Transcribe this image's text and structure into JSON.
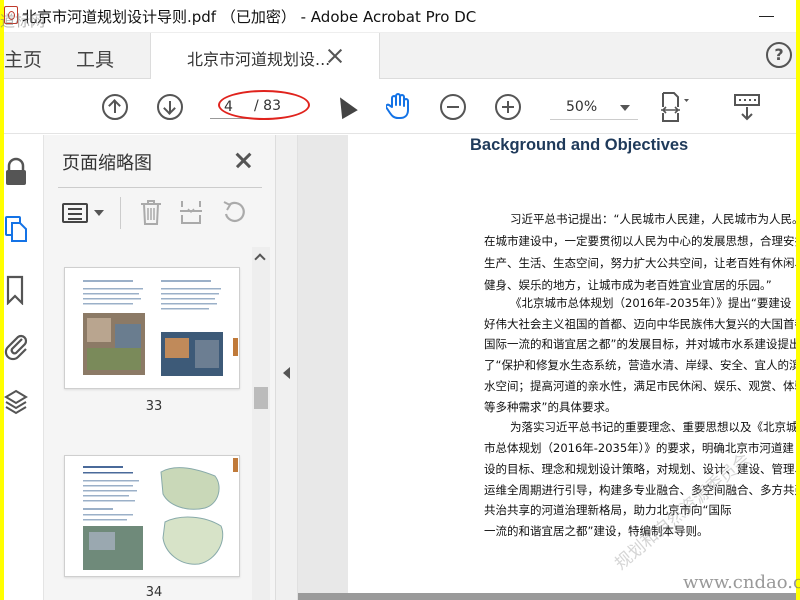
{
  "window": {
    "title": "北京市河道规划设计导则.pdf （已加密） - Adobe Acrobat Pro DC"
  },
  "tabs": {
    "home": "主页",
    "tools": "工具",
    "document": "北京市河道规划设..."
  },
  "toolbar": {
    "page_current": "4",
    "page_total": "/ 83",
    "zoom": "50%"
  },
  "panel": {
    "title": "页面缩略图",
    "thumbnails": [
      {
        "label": "33"
      },
      {
        "label": "34"
      }
    ]
  },
  "document": {
    "heading": "Background and Objectives",
    "lines": [
      "习近平总书记提出：“人民城市人民建，人民城市为人民。",
      "在城市建设中，一定要贯彻以人民为中心的发展思想，合理安排",
      "生产、生活、生态空间，努力扩大公共空间，让老百姓有休闲、",
      "健身、娱乐的地方，让城市成为老百姓宜业宜居的乐园。”",
      "《北京城市总体规划（2016年-2035年）》提出“要建设",
      "好伟大社会主义祖国的首都、迈向中华民族伟大复兴的大国首都",
      "国际一流的和谐宜居之都”的发展目标，并对城市水系建设提出",
      "了“保护和修复水生态系统，营造水清、岸绿、安全、宜人的滨",
      "水空间；提高河道的亲水性，满足市民休闲、娱乐、观赏、体验",
      "等多种需求”的具体要求。",
      "为落实习近平总书记的重要理念、重要思想以及《北京城",
      "市总体规划（2016年-2035年）》的要求，明确北京市河道建",
      "设的目标、理念和规划设计策略，对规划、设计、建设、管理、",
      "运维全周期进行引导，构建多专业融合、多空间融合、多方共建",
      "共治共享的河道治理新格局，助力北京市向“国际",
      "一流的和谐宜居之都”建设，特编制本导则。"
    ],
    "watermark": "规划和自然资源委员会"
  },
  "site_watermark": {
    "top": "道标网",
    "bottom": "www.cndao.com"
  },
  "colors": {
    "accent": "#1473e6",
    "annotation": "#e0231d",
    "border": "#ffff00"
  }
}
